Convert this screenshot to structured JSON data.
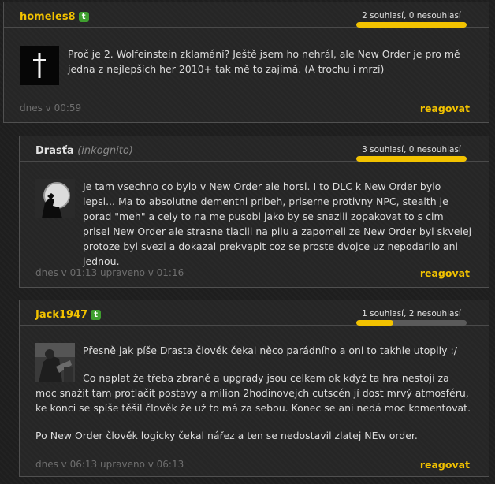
{
  "colors": {
    "accent": "#f2c200",
    "badge": "#3f9f2f",
    "bar_track": "#5a5a5a"
  },
  "comments": [
    {
      "author": "homeles8",
      "author_badge": "t",
      "votes_label": "2 souhlasí, 0 nesouhlasí",
      "agree_fraction": 1.0,
      "avatar_icon": "cross-icon",
      "paragraphs": [
        "Proč je 2. Wolfeinstein zklamání? Ještě jsem ho nehrál, ale New Order je pro mě jedna z nejlepších her 2010+ tak mě to zajímá. (A trochu i mrzí)"
      ],
      "time": "dnes v 00:59",
      "reply_label": "reagovat"
    },
    {
      "author": "Drasťa",
      "author_suffix": "(inkognito)",
      "votes_label": "3 souhlasí, 0 nesouhlasí",
      "agree_fraction": 1.0,
      "avatar_icon": "moon-silhouette-avatar",
      "paragraphs": [
        "Je tam vsechno co bylo v New Order ale horsi. I to DLC k New Order bylo lepsi... Ma to absolutne dementni pribeh, priserne protivny NPC, stealth je porad \"meh\" a cely to na me pusobi jako by se snazili zopakovat to s cim prisel New Order ale strasne tlacili na pilu a zapomeli ze New Order byl skvelej protoze byl svezi a dokazal prekvapit coz se proste dvojce uz nepodarilo ani jednou."
      ],
      "time": "dnes v 01:13 upraveno v 01:16",
      "reply_label": "reagovat"
    },
    {
      "author": "Jack1947",
      "author_badge": "t",
      "votes_label": "1 souhlasí, 2 nesouhlasí",
      "agree_fraction": 0.333,
      "avatar_icon": "game-scene-avatar",
      "paragraphs": [
        "Přesně jak píše Drasta člověk čekal něco parádního a oni to takhle utopily :/",
        "Co naplat že třeba zbraně a upgrady jsou celkem ok když ta hra nestojí za moc snažit tam protlačit postavy a milion 2hodinovejch cutscén jí dost mrvý atmosféru, ke konci se spíše těšil člověk že už to má za sebou. Konec se ani nedá moc komentovat.",
        "Po New Order člověk logicky čekal nářez a ten se nedostavil zlatej NEw order."
      ],
      "time": "dnes v 06:13 upraveno v 06:13",
      "reply_label": "reagovat"
    }
  ]
}
